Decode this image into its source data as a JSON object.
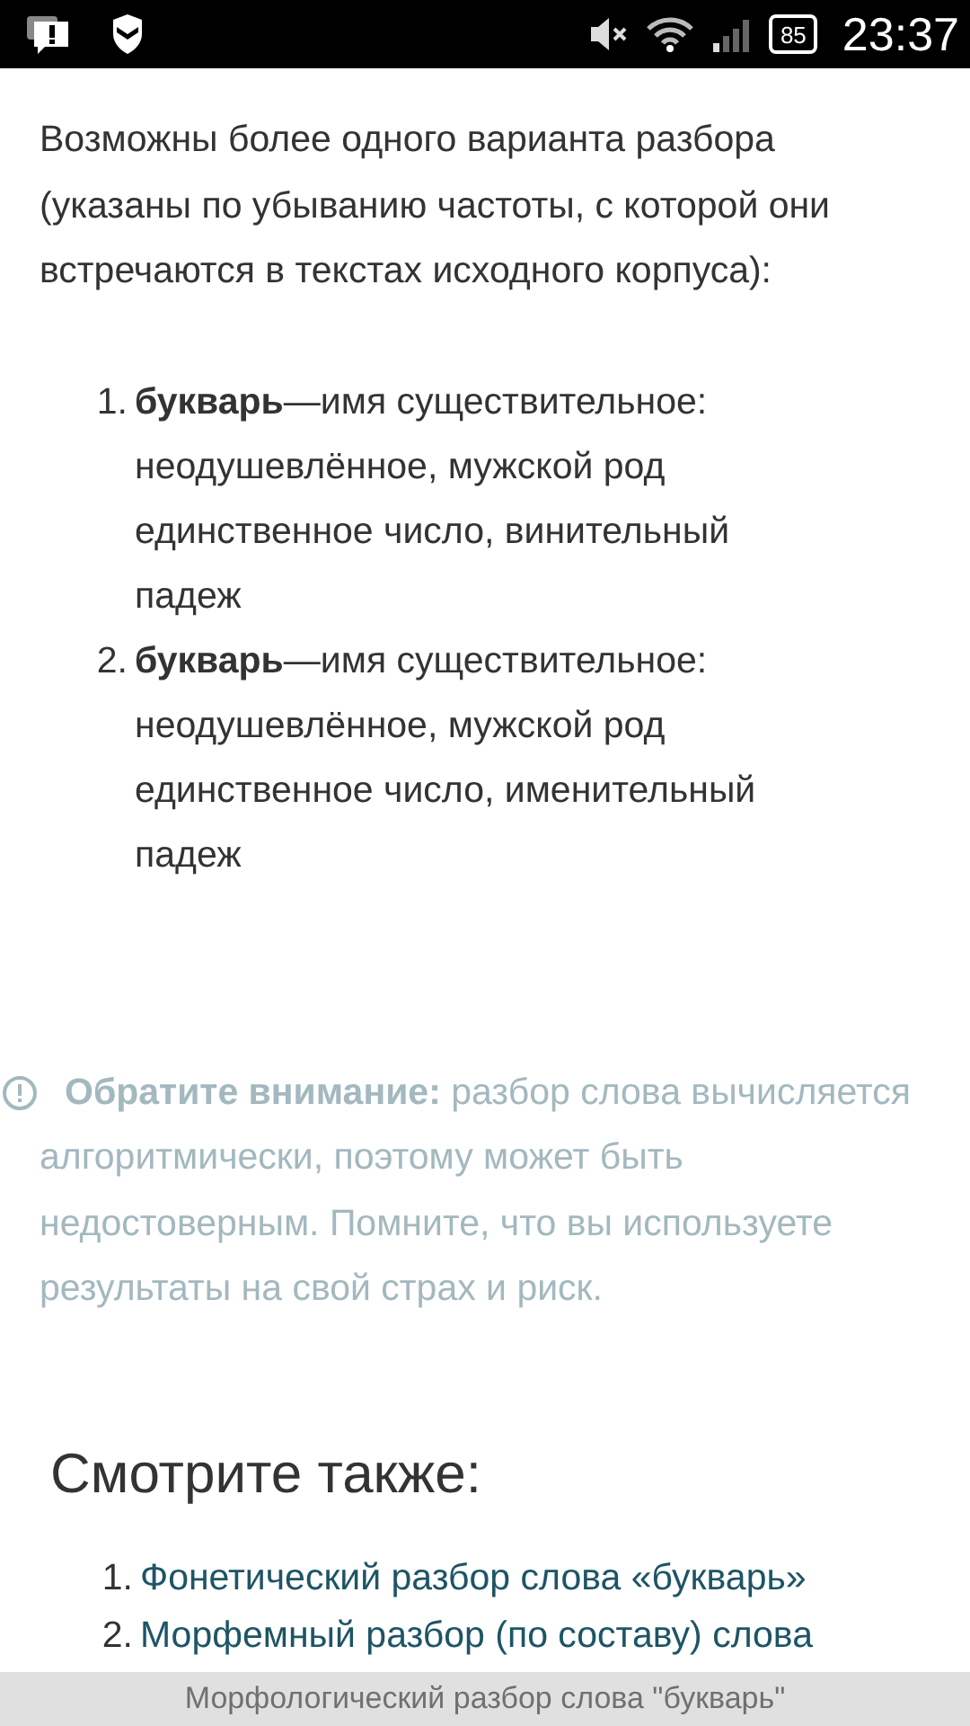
{
  "status_bar": {
    "battery": "85",
    "time": "23:37"
  },
  "intro": "Возможны более одного варианта разбора (указаны по убыванию частоты, с которой они встречаются в текстах исходного корпуса):",
  "parses": [
    {
      "number": "1.",
      "text": "**букварь**—имя существительное: неодушевлённое, мужской род единственное число, винительный падеж"
    },
    {
      "number": "2.",
      "text": "**букварь**—имя существительное: неодушевлённое, мужской род единственное число, именительный падеж"
    }
  ],
  "notice": "**Обратите внимание:** разбор слова вычисляется алгоритмически, поэтому может быть недостоверным. Помните, что вы используете результаты на свой страх и риск.",
  "see_also": {
    "heading": "Смотрите также:",
    "links": [
      {
        "number": "1.",
        "text": "Фонетический разбор слова «букварь»"
      },
      {
        "number": "2.",
        "text": "Морфемный разбор (по составу) слова"
      }
    ]
  },
  "page_title_bar": "Морфологический разбор слова \"букварь\""
}
